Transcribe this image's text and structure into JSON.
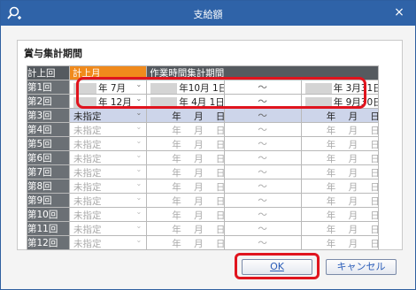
{
  "window": {
    "title": "支給額",
    "search_icon": "magnifier-plus-icon",
    "close_label": "×"
  },
  "group": {
    "title": "賞与集計期間"
  },
  "table": {
    "headers": {
      "round": "計上回",
      "month": "計上月",
      "period": "作業時間集計期間"
    },
    "rows": [
      {
        "label": "第1回",
        "month": "年  7月",
        "start": "年10月  1日",
        "tilde": "～",
        "end": "年  3月31日",
        "state": "filled"
      },
      {
        "label": "第2回",
        "month": "年 12月",
        "start": "年  4月  1日",
        "tilde": "～",
        "end": "年  9月30日",
        "state": "filled"
      },
      {
        "label": "第3回",
        "month": "未指定",
        "start": "年  月  日",
        "tilde": "～",
        "end": "年  月  日",
        "state": "selected"
      },
      {
        "label": "第4回",
        "month": "未指定",
        "start": "年  月  日",
        "tilde": "～",
        "end": "年  月  日",
        "state": "disabled"
      },
      {
        "label": "第5回",
        "month": "未指定",
        "start": "年  月  日",
        "tilde": "～",
        "end": "年  月  日",
        "state": "disabled"
      },
      {
        "label": "第6回",
        "month": "未指定",
        "start": "年  月  日",
        "tilde": "～",
        "end": "年  月  日",
        "state": "disabled"
      },
      {
        "label": "第7回",
        "month": "未指定",
        "start": "年  月  日",
        "tilde": "～",
        "end": "年  月  日",
        "state": "disabled"
      },
      {
        "label": "第8回",
        "month": "未指定",
        "start": "年  月  日",
        "tilde": "～",
        "end": "年  月  日",
        "state": "disabled"
      },
      {
        "label": "第9回",
        "month": "未指定",
        "start": "年  月  日",
        "tilde": "～",
        "end": "年  月  日",
        "state": "disabled"
      },
      {
        "label": "第10回",
        "month": "未指定",
        "start": "年  月  日",
        "tilde": "～",
        "end": "年  月  日",
        "state": "disabled"
      },
      {
        "label": "第11回",
        "month": "未指定",
        "start": "年  月  日",
        "tilde": "～",
        "end": "年  月  日",
        "state": "disabled"
      },
      {
        "label": "第12回",
        "month": "未指定",
        "start": "年  月  日",
        "tilde": "～",
        "end": "年  月  日",
        "state": "disabled"
      }
    ]
  },
  "buttons": {
    "ok": "OK",
    "cancel": "キャンセル"
  },
  "colors": {
    "titlebar": "#2f63a8",
    "header_active": "#f08a1c",
    "highlight": "#e0141e",
    "selected_row": "#cdd5ea"
  }
}
